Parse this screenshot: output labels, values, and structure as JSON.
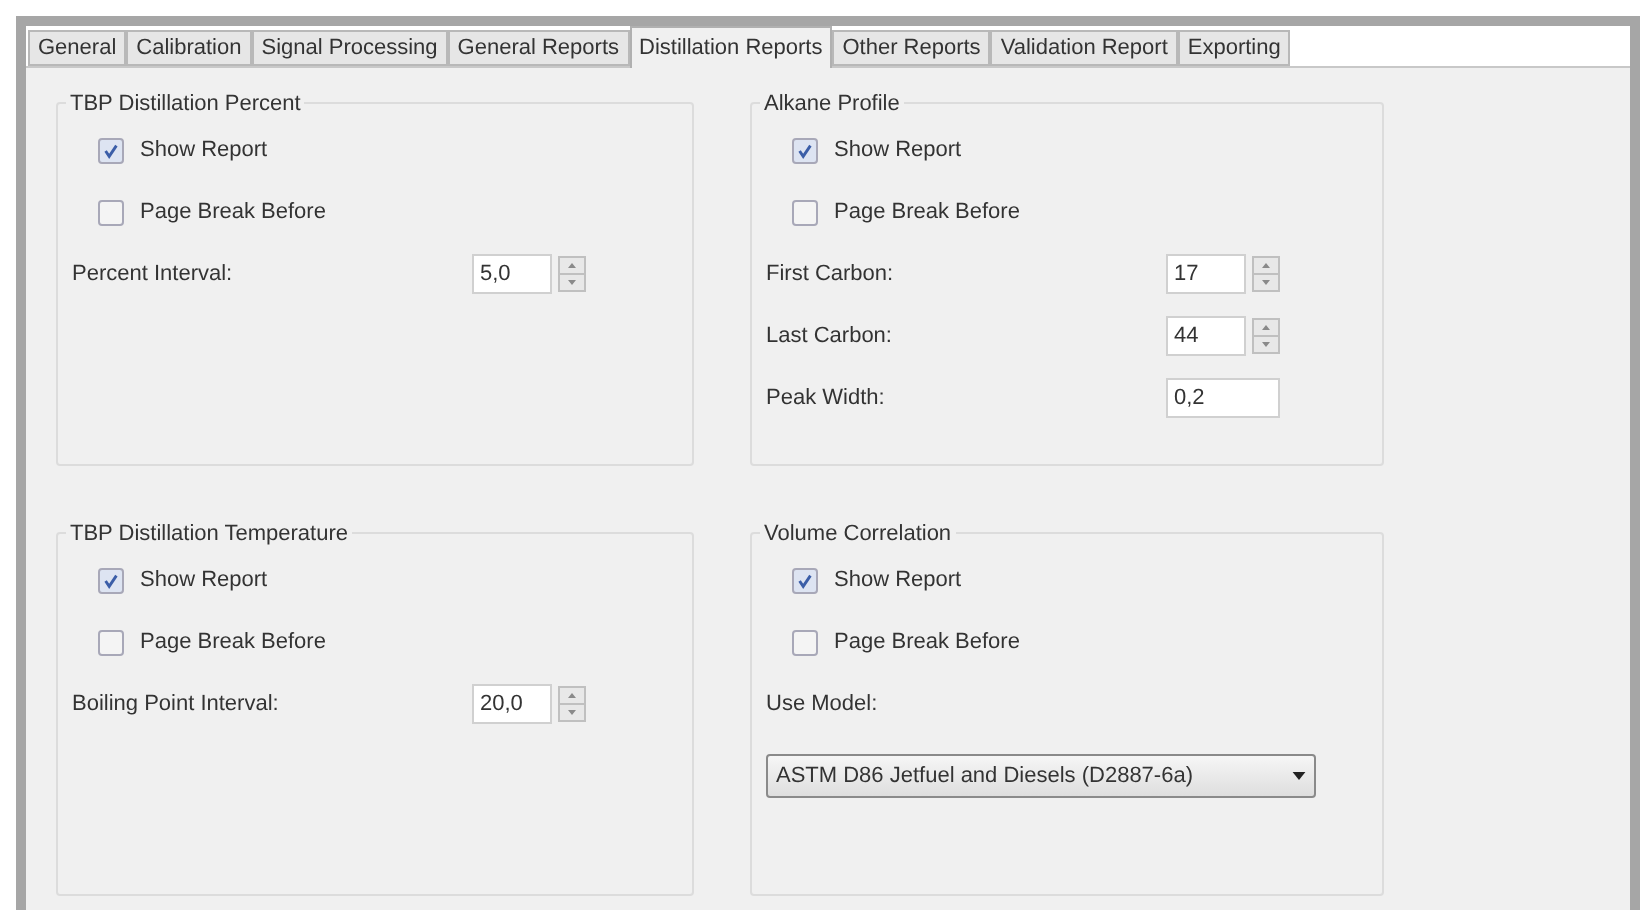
{
  "tabs": [
    {
      "label": "General",
      "selected": false
    },
    {
      "label": "Calibration",
      "selected": false
    },
    {
      "label": "Signal Processing",
      "selected": false
    },
    {
      "label": "General Reports",
      "selected": false
    },
    {
      "label": "Distillation Reports",
      "selected": true
    },
    {
      "label": "Other Reports",
      "selected": false
    },
    {
      "label": "Validation Report",
      "selected": false
    },
    {
      "label": "Exporting",
      "selected": false
    }
  ],
  "groups": [
    {
      "title": "TBP Distillation Percent",
      "fields": [
        {
          "kind": "checkbox",
          "label": "Show Report",
          "checked": true
        },
        {
          "kind": "checkbox",
          "label": "Page Break Before",
          "checked": false
        },
        {
          "kind": "spinner",
          "label": "Percent Interval:",
          "value": "5,0"
        }
      ]
    },
    {
      "title": "Alkane Profile",
      "fields": [
        {
          "kind": "checkbox",
          "label": "Show Report",
          "checked": true
        },
        {
          "kind": "checkbox",
          "label": "Page Break Before",
          "checked": false
        },
        {
          "kind": "spinner",
          "label": "First Carbon:",
          "value": "17"
        },
        {
          "kind": "spinner",
          "label": "Last Carbon:",
          "value": "44"
        },
        {
          "kind": "textbox",
          "label": "Peak Width:",
          "value": "0,2"
        }
      ]
    },
    {
      "title": "TBP Distillation Temperature",
      "fields": [
        {
          "kind": "checkbox",
          "label": "Show Report",
          "checked": true
        },
        {
          "kind": "checkbox",
          "label": "Page Break Before",
          "checked": false
        },
        {
          "kind": "spinner",
          "label": "Boiling Point Interval:",
          "value": "20,0"
        }
      ]
    },
    {
      "title": "Volume Correlation",
      "fields": [
        {
          "kind": "checkbox",
          "label": "Show Report",
          "checked": true
        },
        {
          "kind": "checkbox",
          "label": "Page Break Before",
          "checked": false
        },
        {
          "kind": "label",
          "label": "Use Model:"
        },
        {
          "kind": "dropdown",
          "value": "ASTM D86 Jetfuel and Diesels (D2887-6a)"
        }
      ]
    }
  ]
}
